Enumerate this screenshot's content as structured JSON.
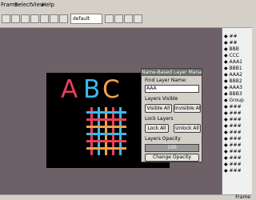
{
  "menu": [
    "Frame",
    "Select",
    "View",
    "Help"
  ],
  "toolbar": {
    "select_value": "default"
  },
  "layers": [
    "◆ ##",
    "◆ ##",
    "◆ BBB",
    "◆ CCC",
    "◆ AAA1",
    "◆ BBB1",
    "◆ AAA2",
    "◆ BBB2",
    "◆ AAA3",
    "◆ BBB3",
    "◆ Group",
    "◆ ###",
    "◆ ###",
    "◆ ###",
    "◆ ###",
    "◆ ###",
    "◆ ###",
    "◆ ###",
    "◆ ###",
    "◆ ###",
    "◆ ###",
    "◆ ###"
  ],
  "canvas": {
    "letters": [
      "A",
      "B",
      "C"
    ],
    "colors": {
      "A": "#e8405a",
      "B": "#3fb8e8",
      "C": "#f0a050"
    }
  },
  "dialog": {
    "title": "Name-Based Layer Manager",
    "find_label": "Find Layer Name:",
    "find_value": "AAA",
    "visible_label": "Layers Visible",
    "visible_all": "Visible All",
    "invisible_all": "Invisible All",
    "lock_label": "Lock Layers",
    "lock_all": "Lock All",
    "unlock_all": "Unlock All",
    "opacity_label": "Layers Opacity",
    "opacity_value": "100",
    "change_opacity": "Change Opacity"
  },
  "status": {
    "right_text": "Frame"
  }
}
